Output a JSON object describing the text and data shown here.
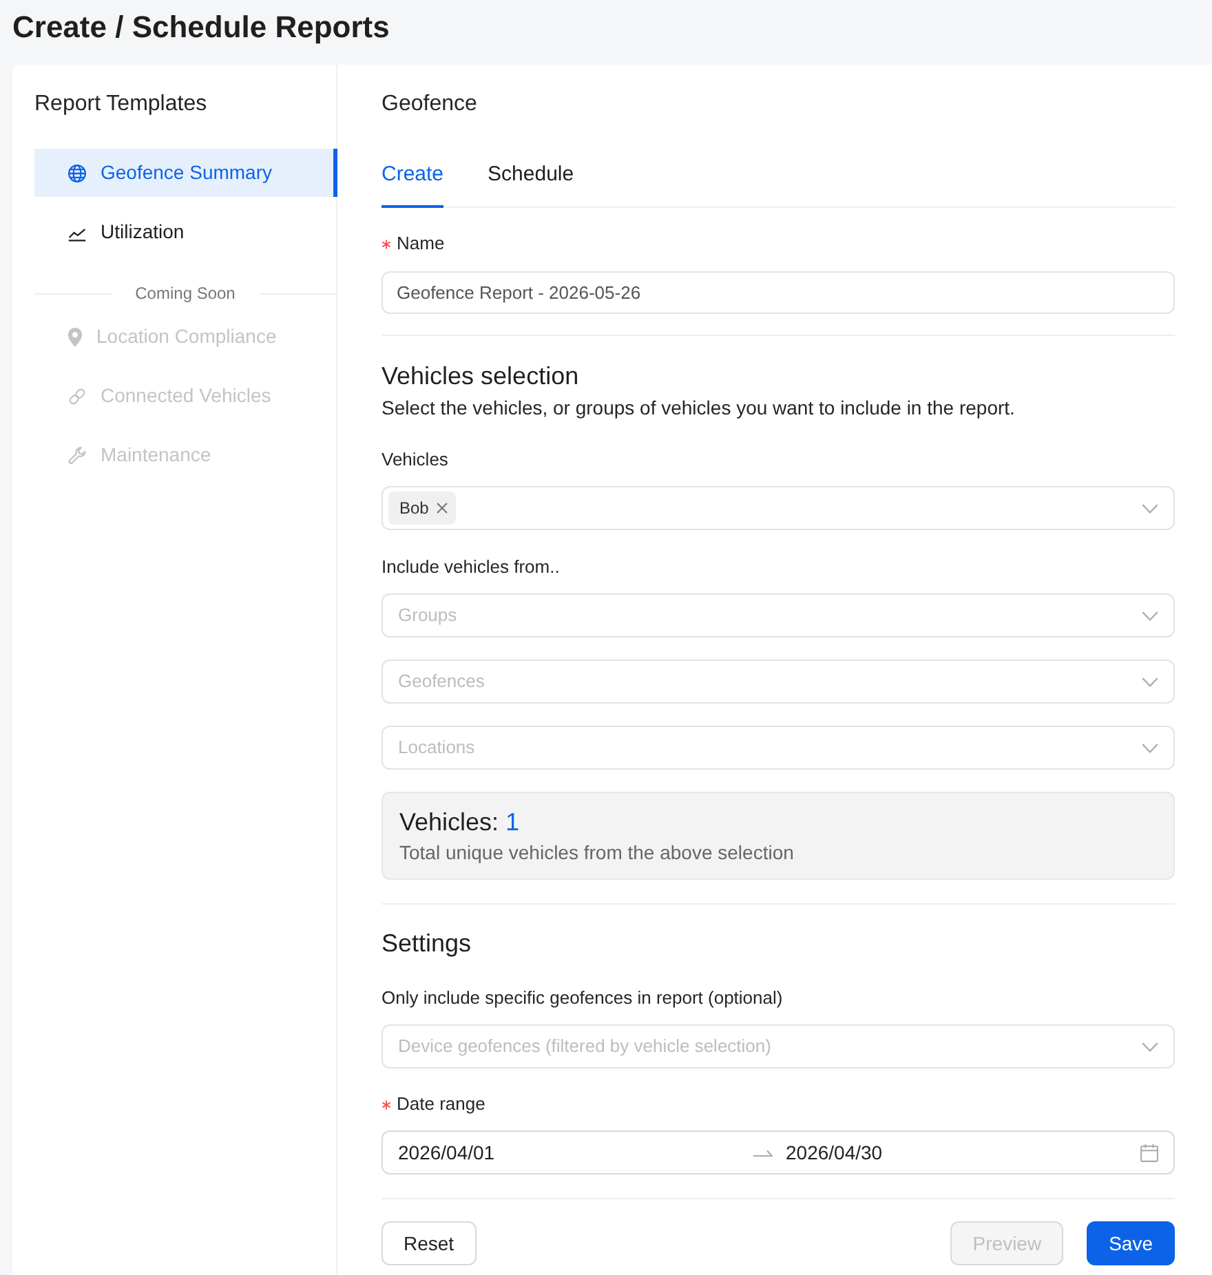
{
  "page": {
    "title": "Create / Schedule Reports"
  },
  "sidebar": {
    "title": "Report Templates",
    "items": [
      {
        "label": "Geofence Summary",
        "selected": true
      },
      {
        "label": "Utilization",
        "selected": false
      }
    ],
    "coming_soon": {
      "label": "Coming Soon",
      "items": [
        {
          "label": "Location Compliance",
          "disabled": true
        },
        {
          "label": "Connected Vehicles",
          "disabled": true
        },
        {
          "label": "Maintenance",
          "disabled": true
        }
      ]
    }
  },
  "panel": {
    "title": "Geofence",
    "tabs": [
      {
        "label": "Create",
        "selected": true
      },
      {
        "label": "Schedule",
        "selected": false
      }
    ]
  },
  "form": {
    "name": {
      "label": "Name",
      "required": true,
      "value": "Geofence Report - 2026-05-26"
    },
    "vehicles_selection": {
      "heading": "Vehicles selection",
      "description": "Select the vehicles, or groups of vehicles you want to include in the report.",
      "vehicles": {
        "label": "Vehicles",
        "tags": [
          "Bob"
        ]
      },
      "include_label": "Include vehicles from..",
      "sources": [
        {
          "placeholder": "Groups"
        },
        {
          "placeholder": "Geofences"
        },
        {
          "placeholder": "Locations"
        }
      ],
      "summary": {
        "label": "Vehicles:",
        "count": "1",
        "note": "Total unique vehicles from the above selection"
      }
    },
    "settings": {
      "heading": "Settings",
      "geofences": {
        "label": "Only include specific geofences in report (optional)",
        "placeholder": "Device geofences (filtered by vehicle selection)"
      },
      "date_range": {
        "label": "Date range",
        "required": true,
        "start": "2026/04/01",
        "end": "2026/04/30"
      }
    }
  },
  "actions": [
    {
      "label": "Reset",
      "kind": "default",
      "disabled": false
    },
    {
      "label": "Preview",
      "kind": "default",
      "disabled": true
    },
    {
      "label": "Save",
      "kind": "primary",
      "disabled": false
    }
  ]
}
